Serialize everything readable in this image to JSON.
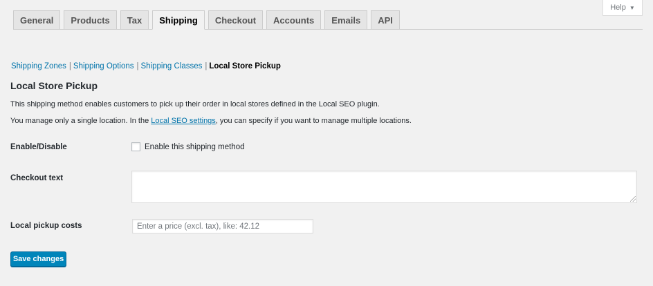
{
  "help": {
    "label": "Help"
  },
  "tabs": [
    {
      "label": "General"
    },
    {
      "label": "Products"
    },
    {
      "label": "Tax"
    },
    {
      "label": "Shipping",
      "active": true
    },
    {
      "label": "Checkout"
    },
    {
      "label": "Accounts"
    },
    {
      "label": "Emails"
    },
    {
      "label": "API"
    }
  ],
  "subnav": {
    "items": [
      "Shipping Zones",
      "Shipping Options",
      "Shipping Classes"
    ],
    "separator": "|",
    "current": "Local Store Pickup"
  },
  "section": {
    "title": "Local Store Pickup",
    "description1": "This shipping method enables customers to pick up their order in local stores defined in the Local SEO plugin.",
    "description2_before": "You manage only a single location. In the ",
    "description2_link": "Local SEO settings",
    "description2_after": ", you can specify if you want to manage multiple locations."
  },
  "fields": {
    "enable": {
      "label": "Enable/Disable",
      "checkbox_label": "Enable this shipping method",
      "checked": false
    },
    "checkout_text": {
      "label": "Checkout text",
      "value": ""
    },
    "pickup_costs": {
      "label": "Local pickup costs",
      "placeholder": "Enter a price (excl. tax), like: 42.12",
      "value": ""
    }
  },
  "save_button": {
    "label": "Save changes"
  },
  "colors": {
    "accent": "#0085ba",
    "link": "#0073aa",
    "background": "#f1f1f1"
  },
  "icons": {
    "help_dropdown": "caret-down-icon"
  }
}
